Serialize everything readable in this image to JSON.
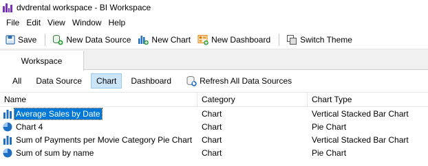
{
  "window": {
    "title": "dvdrental workspace - BI Workspace"
  },
  "menu": [
    "File",
    "Edit",
    "View",
    "Window",
    "Help"
  ],
  "toolbar": {
    "save": "Save",
    "new_data_source": "New Data Source",
    "new_chart": "New Chart",
    "new_dashboard": "New Dashboard",
    "switch_theme": "Switch Theme"
  },
  "tabs": {
    "workspace": "Workspace"
  },
  "filters": {
    "all": "All",
    "data_source": "Data Source",
    "chart": "Chart",
    "dashboard": "Dashboard",
    "refresh": "Refresh All Data Sources",
    "active": "chart"
  },
  "table": {
    "headers": {
      "name": "Name",
      "category": "Category",
      "type": "Chart Type"
    },
    "rows": [
      {
        "name": "Average Sales by Date",
        "category": "Chart",
        "type": "Vertical Stacked Bar Chart",
        "icon": "bar-chart-icon",
        "selected": true
      },
      {
        "name": "Chart 4",
        "category": "Chart",
        "type": "Pie Chart",
        "icon": "pie-chart-icon",
        "selected": false
      },
      {
        "name": "Sum of Payments per Movie Category Pie Chart",
        "category": "Chart",
        "type": "Vertical Stacked Bar Chart",
        "icon": "bar-chart-icon",
        "selected": false
      },
      {
        "name": "Sum of sum by name",
        "category": "Chart",
        "type": "Pie Chart",
        "icon": "pie-chart-icon",
        "selected": false
      }
    ]
  },
  "colors": {
    "selection": "#0078d7",
    "active_filter": "#cce4f7",
    "brand": "#7b2fbf",
    "chart_icon": "#1e6fc4"
  }
}
